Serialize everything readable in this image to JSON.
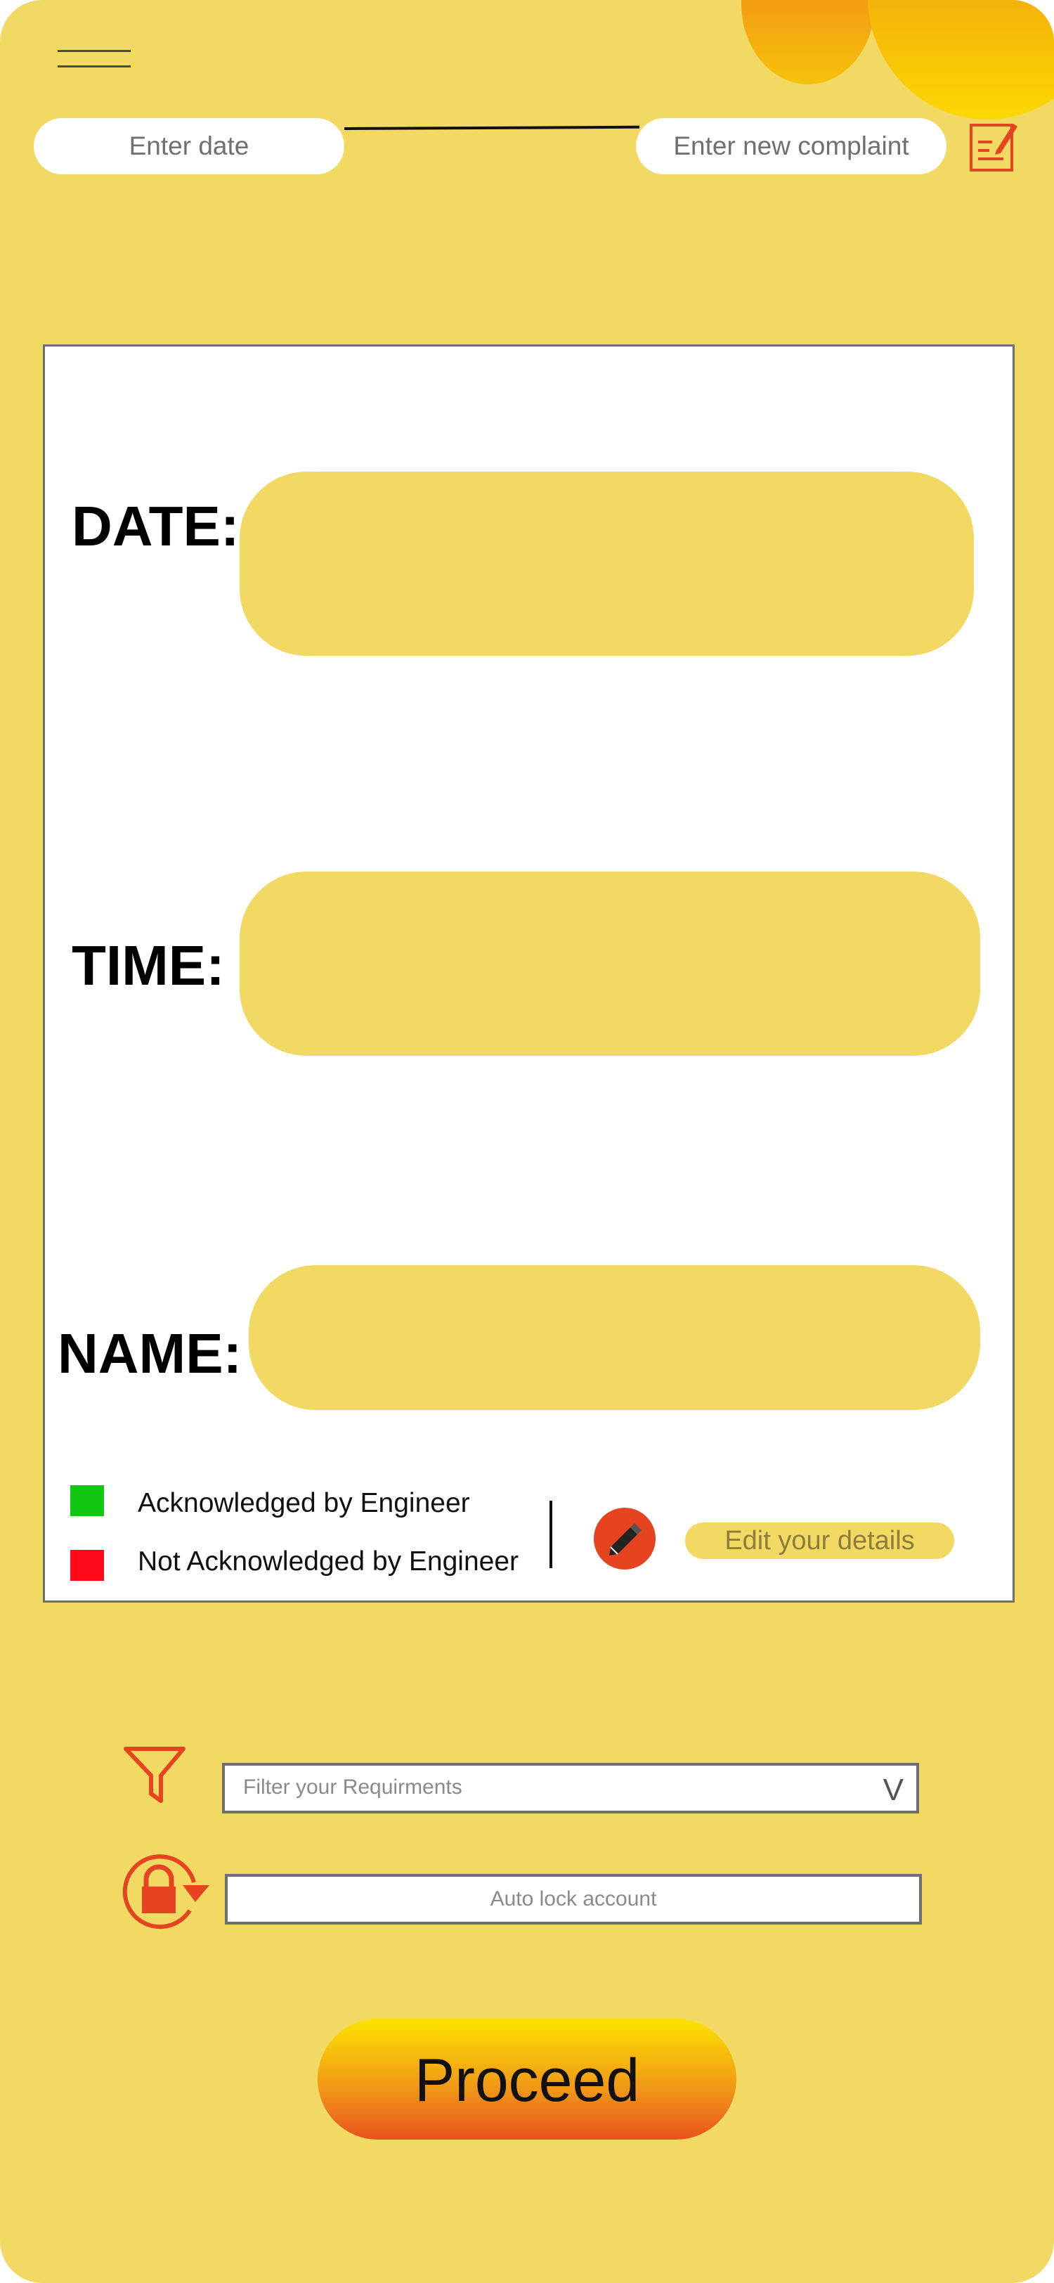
{
  "colors": {
    "background": "#f1d964",
    "accent": "#e64420",
    "acknowledged": "#12c712",
    "not_acknowledged": "#ff0a1a"
  },
  "header": {
    "menu_icon": "hamburger-menu-icon",
    "date_placeholder": "Enter date",
    "complaint_placeholder": "Enter new complaint",
    "complaint_icon": "note-edit-icon"
  },
  "form": {
    "date_label": "DATE:",
    "time_label": "TIME:",
    "name_label": "NAME:"
  },
  "legend": {
    "acknowledged": "Acknowledged by Engineer",
    "not_acknowledged": "Not Acknowledged by Engineer"
  },
  "edit": {
    "icon": "pencil-icon",
    "label": "Edit your details"
  },
  "filter": {
    "icon": "funnel-icon",
    "placeholder": "Filter your Requirments",
    "arrow": "V"
  },
  "autolock": {
    "icon": "lock-refresh-icon",
    "label": "Auto lock account"
  },
  "proceed": {
    "label": "Proceed"
  }
}
